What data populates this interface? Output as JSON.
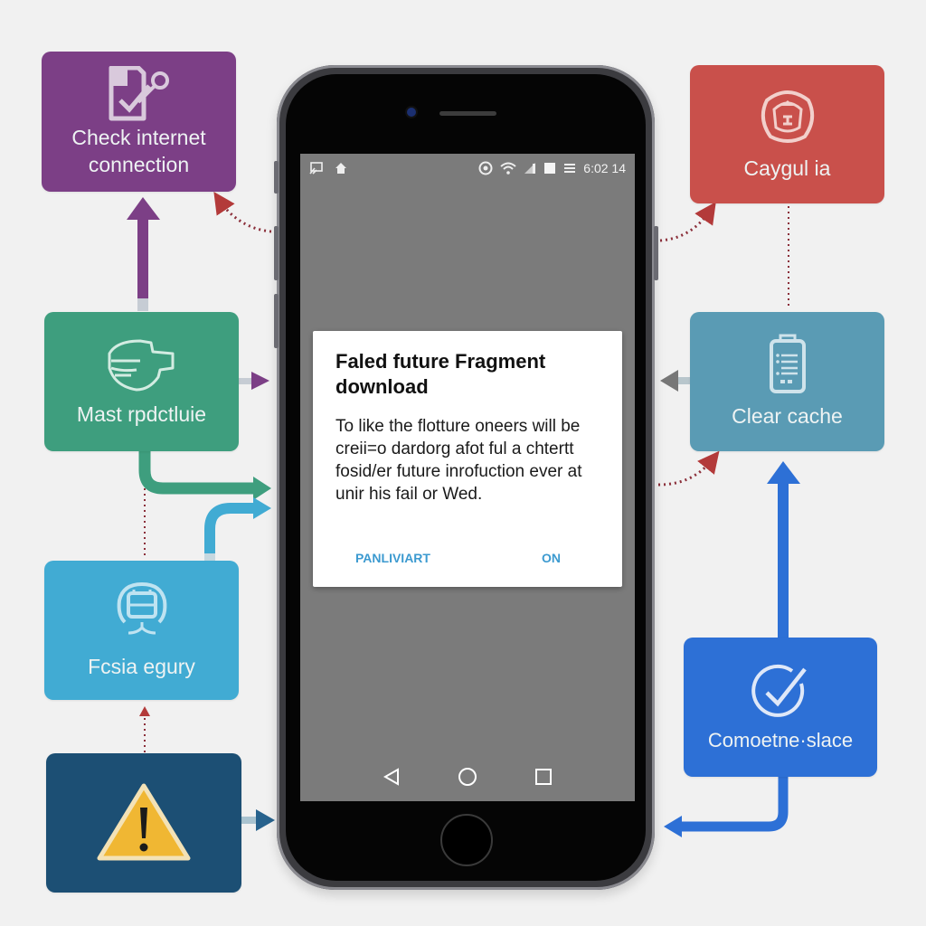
{
  "colors": {
    "background": "#f1f1f1",
    "purple": "#7c3f86",
    "red": "#c9504b",
    "green": "#3e9e7e",
    "teal": "#5a9bb4",
    "light_blue": "#41abd3",
    "blue": "#2d70d6",
    "navy": "#1c4f74",
    "warning_yellow": "#f0b733",
    "dialog_button": "#3c9ad0",
    "dotted_arrow": "#b33a3a"
  },
  "cards": {
    "check": {
      "label": "Check internet connection",
      "icon": "document-check-key-icon"
    },
    "caygul": {
      "label": "Caygul ia",
      "icon": "robot-face-icon"
    },
    "mast": {
      "label": "Mast rpdctluie",
      "icon": "hand-glove-icon"
    },
    "clear": {
      "label": "Clear cache",
      "icon": "battery-list-icon"
    },
    "fcsia": {
      "label": "Fcsia egury",
      "icon": "router-device-icon"
    },
    "complete": {
      "label": "Comoetne·slace",
      "icon": "circle-check-icon"
    },
    "warning": {
      "label": "",
      "icon": "warning-triangle-icon"
    }
  },
  "phone": {
    "status_bar": {
      "left_icons": [
        "cast-icon",
        "home-icon"
      ],
      "right_icons": [
        "alarm-icon",
        "wifi-icon",
        "signal-icon",
        "sim-icon",
        "battery-icon"
      ],
      "time": "6:02 14"
    },
    "dialog": {
      "title": "Faled future Fragment download",
      "body": "To like the flotture oneers will be creii=o dardorg afot ful a chtertt fosid/er future inrofuction ever at unir his fail or Wed.",
      "negative_button": "PANLIVIART",
      "positive_button": "ON"
    },
    "nav": [
      "back-icon",
      "home-circle-icon",
      "recents-icon"
    ]
  }
}
